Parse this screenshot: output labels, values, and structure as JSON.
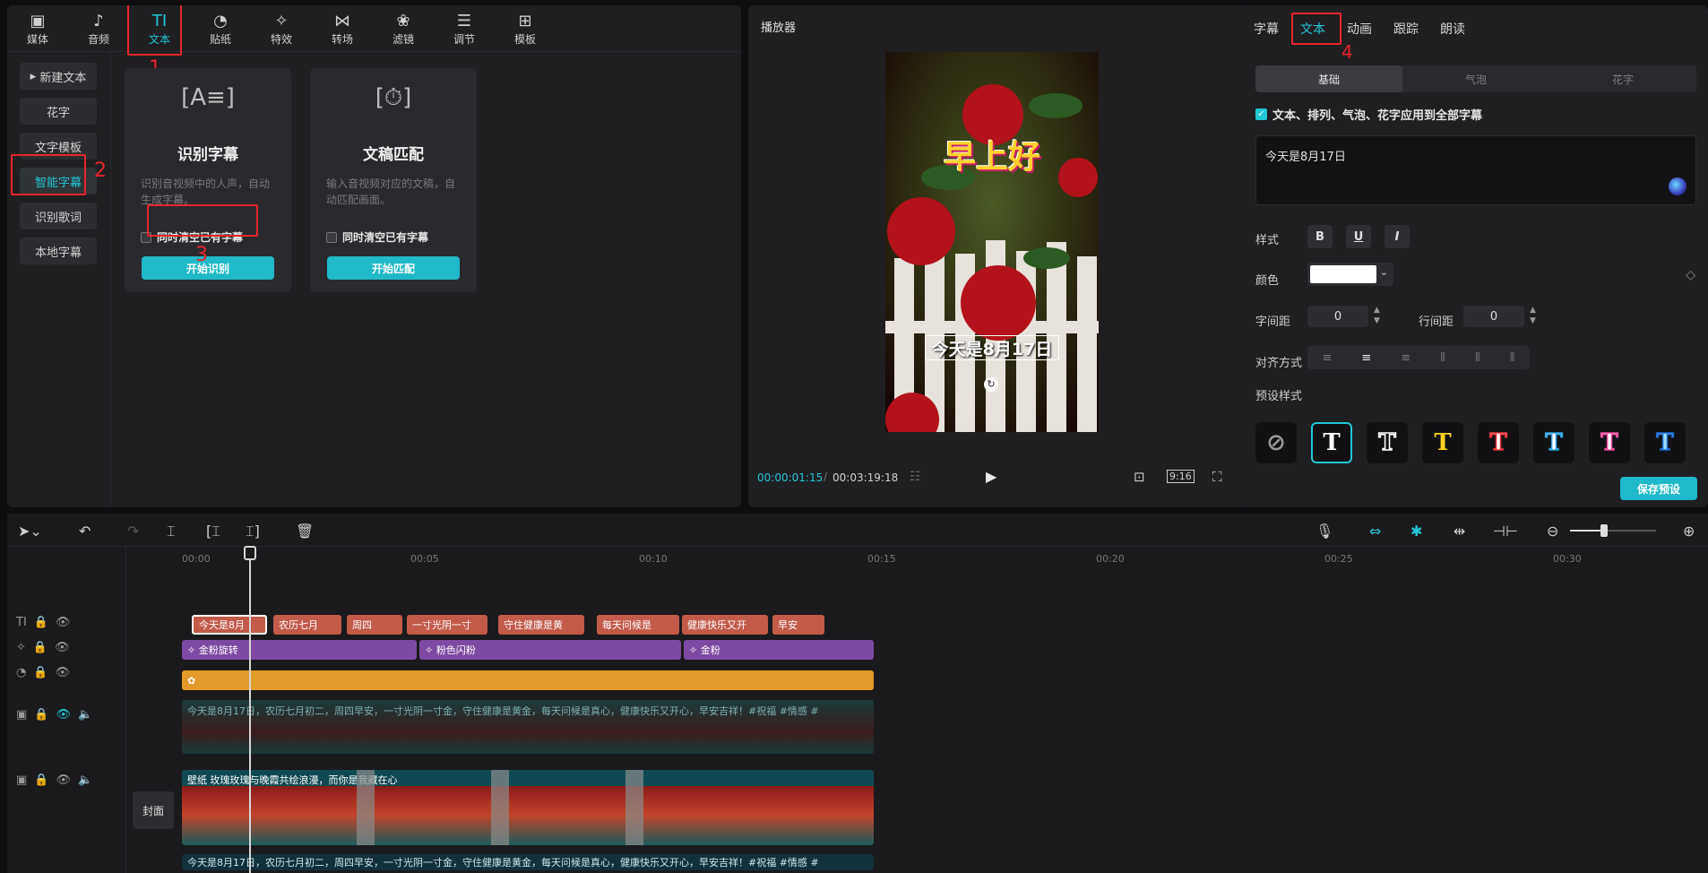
{
  "toolbar": {
    "items": [
      {
        "label": "媒体",
        "icon": "media-icon"
      },
      {
        "label": "音频",
        "icon": "audio-icon"
      },
      {
        "label": "文本",
        "icon": "text-icon"
      },
      {
        "label": "贴纸",
        "icon": "sticker-icon"
      },
      {
        "label": "特效",
        "icon": "effects-icon"
      },
      {
        "label": "转场",
        "icon": "transition-icon"
      },
      {
        "label": "滤镜",
        "icon": "filter-icon"
      },
      {
        "label": "调节",
        "icon": "adjust-icon"
      },
      {
        "label": "模板",
        "icon": "template-icon"
      }
    ],
    "active_index": 2
  },
  "sidebar": {
    "items": [
      "新建文本",
      "花字",
      "文字模板",
      "智能字幕",
      "识别歌词",
      "本地字幕"
    ],
    "active_index": 3
  },
  "cards": [
    {
      "title": "识别字幕",
      "desc": "识别音视频中的人声，自动生成字幕。",
      "checkbox": "同时清空已有字幕",
      "button": "开始识别"
    },
    {
      "title": "文稿匹配",
      "desc": "输入音视频对应的文稿，自动匹配画面。",
      "checkbox": "同时清空已有字幕",
      "button": "开始匹配"
    }
  ],
  "annotations": [
    "1",
    "2",
    "3",
    "4"
  ],
  "player": {
    "title": "播放器",
    "current_time": "00:00:01:15",
    "total_time": "00:03:19:18",
    "ratio": "9:16",
    "video_headline": "早上好",
    "video_subtitle": "今天是8月17日"
  },
  "right": {
    "tabs": [
      "字幕",
      "文本",
      "动画",
      "跟踪",
      "朗读"
    ],
    "active_tab": 1,
    "segments": [
      "基础",
      "气泡",
      "花字"
    ],
    "apply_all": "文本、排列、气泡、花字应用到全部字幕",
    "text_value": "今天是8月17日",
    "style_label": "样式",
    "style_buttons": [
      "B",
      "U",
      "I"
    ],
    "color_label": "颜色",
    "color_value": "#ffffff",
    "letter_spacing_label": "字间距",
    "letter_spacing_value": "0",
    "line_spacing_label": "行间距",
    "line_spacing_value": "0",
    "align_label": "对齐方式",
    "preset_label": "预设样式",
    "save_button": "保存预设"
  },
  "timeline": {
    "ruler_ticks": [
      "00:00",
      "00:05",
      "00:10",
      "00:15",
      "00:20",
      "00:25",
      "00:30"
    ],
    "text_clips": [
      "今天是8月",
      "农历七月",
      "周四",
      "一寸光阴一寸",
      "守住健康是黄",
      "每天问候是",
      "健康快乐又开",
      "早安"
    ],
    "effect_clips": [
      "金粉旋转",
      "粉色闪粉",
      "金粉"
    ],
    "subtitle_line": "今天是8月17日，农历七月初二，周四早安，一寸光阴一寸金，守住健康是黄金，每天问候是真心，健康快乐又开心，早安吉祥！#祝福 #情感 #",
    "main_clip_label": "壁纸  玫瑰玫瑰与晚霞共绘浪漫，而你是我藏在心",
    "cover_label": "封面"
  }
}
